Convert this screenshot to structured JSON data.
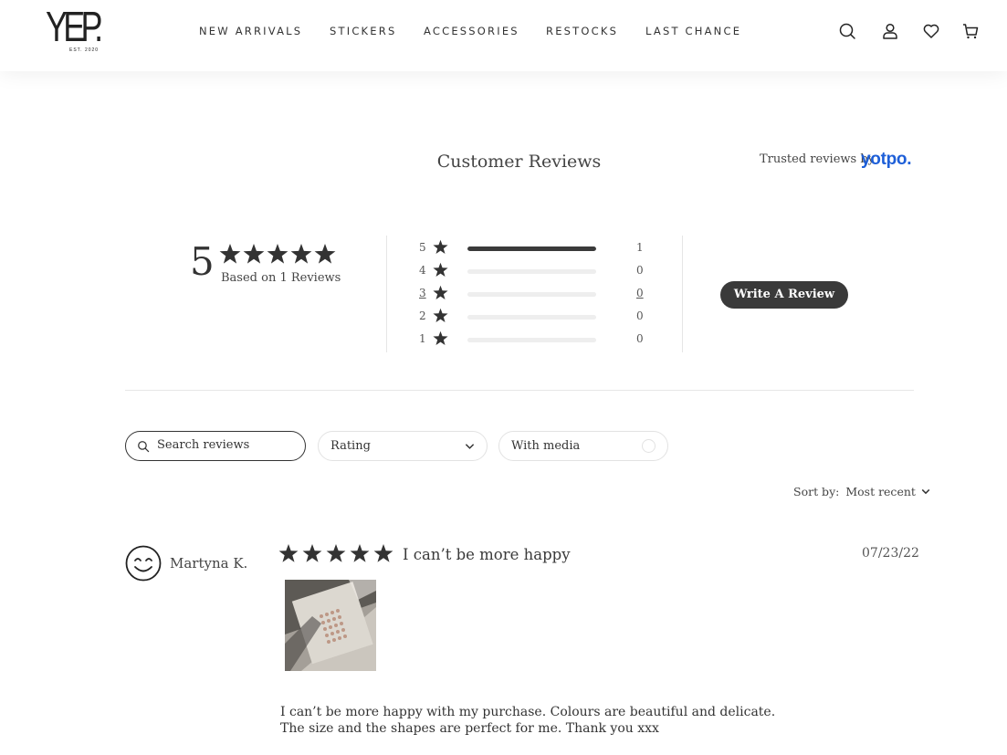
{
  "header": {
    "logo_text": "YEP.",
    "logo_sub": "EST. 2020",
    "nav": [
      "NEW ARRIVALS",
      "STICKERS",
      "ACCESSORIES",
      "RESTOCKS",
      "LAST CHANCE"
    ],
    "icons": [
      "search-icon",
      "account-icon",
      "wishlist-heart-icon",
      "cart-icon"
    ]
  },
  "reviews": {
    "title": "Customer Reviews",
    "trusted_prefix": "Trusted reviews by",
    "trusted_brand": "yotpo.",
    "average": "5",
    "based_on": "Based on 1 Reviews",
    "distribution": [
      {
        "stars": "5",
        "count": "1",
        "fraction": 1
      },
      {
        "stars": "4",
        "count": "0",
        "fraction": 0
      },
      {
        "stars": "3",
        "count": "0",
        "fraction": 0
      },
      {
        "stars": "2",
        "count": "0",
        "fraction": 0
      },
      {
        "stars": "1",
        "count": "0",
        "fraction": 0
      }
    ],
    "write_review": "Write A Review",
    "search_placeholder": "Search reviews",
    "rating_filter": "Rating",
    "media_filter": "With media",
    "sort_label": "Sort by:",
    "sort_value": "Most recent"
  },
  "review": {
    "author": "Martyna K.",
    "rating": 5,
    "title": "I can’t be more happy",
    "date": "07/23/22",
    "body": "I can’t be more happy with my purchase. Colours are beautiful and delicate. The size and the shapes are perfect for me. Thank you xxx"
  },
  "colors": {
    "accent": "#1e5fd8",
    "dark": "#3a3a3a",
    "bar_empty": "#eeeeee"
  }
}
